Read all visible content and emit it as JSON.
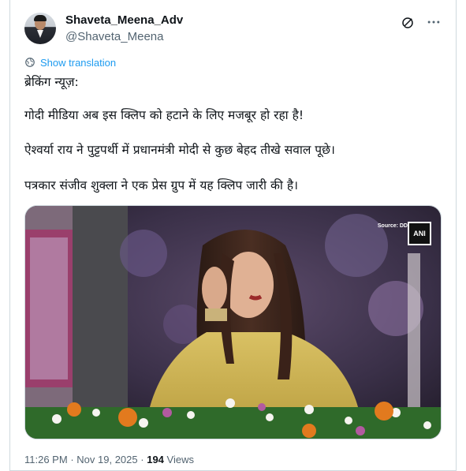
{
  "author": {
    "name": "Shaveta_Meena_Adv",
    "handle": "@Shaveta_Meena"
  },
  "icons": {
    "grok": "grok-icon",
    "more": "more-icon",
    "translate": "globe-icon"
  },
  "translate_label": "Show translation",
  "tweet": {
    "lines": [
      "ब्रेकिंग न्यूज़:",
      "गोदी मीडिया अब इस क्लिप को हटाने के लिए मजबूर हो रहा है!",
      "ऐश्वर्या राय ने पुट्टपर्थी में प्रधानमंत्री मोदी से कुछ बेहद तीखे सवाल पूछे।",
      "पत्रकार संजीव शुक्ला ने एक प्रेस ग्रुप में यह क्लिप जारी की है।"
    ]
  },
  "media": {
    "source_label": "Source: DD",
    "logo_text": "ANI"
  },
  "meta": {
    "time": "11:26 PM",
    "separator": "·",
    "date": "Nov 19, 2025",
    "views_count": "194",
    "views_label": "Views"
  },
  "colors": {
    "link": "#1d9bf0",
    "secondary": "#536471",
    "border": "#cfd9de"
  }
}
